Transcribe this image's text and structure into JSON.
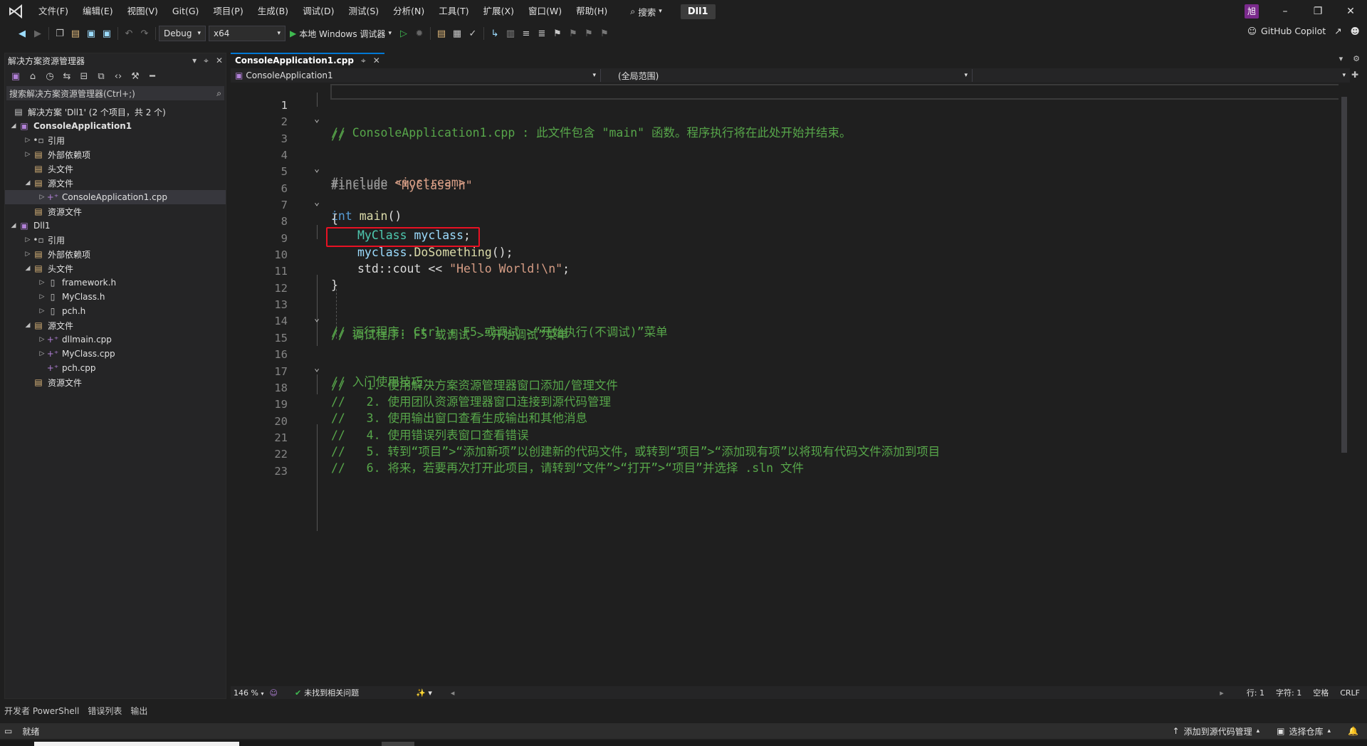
{
  "menubar": {
    "items": [
      "文件(F)",
      "编辑(E)",
      "视图(V)",
      "Git(G)",
      "项目(P)",
      "生成(B)",
      "调试(D)",
      "测试(S)",
      "分析(N)",
      "工具(T)",
      "扩展(X)",
      "窗口(W)",
      "帮助(H)"
    ],
    "search_label": "搜索",
    "project_name": "Dll1",
    "user_initial": "旭"
  },
  "toolbar": {
    "config": "Debug",
    "platform": "x64",
    "run_label": "本地 Windows 调试器",
    "copilot_label": "GitHub Copilot"
  },
  "solution_explorer": {
    "title": "解决方案资源管理器",
    "search_placeholder": "搜索解决方案资源管理器(Ctrl+;)",
    "solution_label": "解决方案 'Dll1' (2 个项目，共 2 个)",
    "nodes": [
      {
        "label": "ConsoleApplication1",
        "bold": true
      },
      {
        "label": "引用"
      },
      {
        "label": "外部依赖项"
      },
      {
        "label": "头文件"
      },
      {
        "label": "源文件"
      },
      {
        "label": "ConsoleApplication1.cpp"
      },
      {
        "label": "资源文件"
      },
      {
        "label": "Dll1"
      },
      {
        "label": "引用"
      },
      {
        "label": "外部依赖项"
      },
      {
        "label": "头文件"
      },
      {
        "label": "framework.h"
      },
      {
        "label": "MyClass.h"
      },
      {
        "label": "pch.h"
      },
      {
        "label": "源文件"
      },
      {
        "label": "dllmain.cpp"
      },
      {
        "label": "MyClass.cpp"
      },
      {
        "label": "pch.cpp"
      },
      {
        "label": "资源文件"
      }
    ]
  },
  "editor": {
    "tab_label": "ConsoleApplication1.cpp",
    "nav_project": "ConsoleApplication1",
    "nav_scope": "(全局范围)",
    "line_numbers": [
      "1",
      "2",
      "3",
      "4",
      "5",
      "6",
      "7",
      "8",
      "9",
      "10",
      "11",
      "12",
      "13",
      "14",
      "15",
      "16",
      "17",
      "18",
      "19",
      "20",
      "21",
      "22",
      "23"
    ],
    "code": {
      "l1": "// ConsoleApplication1.cpp : 此文件包含 \"main\" 函数。程序执行将在此处开始并结束。",
      "l2": "//",
      "l4_pp": "#include ",
      "l4_arg": "<iostream>",
      "l5_pp": "#include ",
      "l5_arg": "\"MyClass.h\"",
      "l6_kw": "int",
      "l6_fn": " main",
      "l6_rest": "()",
      "l7": "{",
      "l8_type": "MyClass",
      "l8_var": " myclass",
      "l8_rest": ";",
      "l9_var": "myclass",
      "l9_dot": ".",
      "l9_fn": "DoSomething",
      "l9_rest": "();",
      "l10_pre": "std::cout << ",
      "l10_str": "\"Hello World!\\n\"",
      "l10_rest": ";",
      "l11": "}",
      "l13": "// 运行程序: Ctrl + F5 或调试 >“开始执行(不调试)”菜单",
      "l14": "// 调试程序: F5 或调试 >“开始调试”菜单",
      "l16": "// 入门使用技巧:",
      "l17": "//   1. 使用解决方案资源管理器窗口添加/管理文件",
      "l18": "//   2. 使用团队资源管理器窗口连接到源代码管理",
      "l19": "//   3. 使用输出窗口查看生成输出和其他消息",
      "l20": "//   4. 使用错误列表窗口查看错误",
      "l21": "//   5. 转到“项目”>“添加新项”以创建新的代码文件，或转到“项目”>“添加现有项”以将现有代码文件添加到项目",
      "l22": "//   6. 将来，若要再次打开此项目，请转到“文件”>“打开”>“项目”并选择 .sln 文件"
    }
  },
  "editor_status": {
    "zoom": "146 %",
    "issues": "未找到相关问题",
    "line": "行: 1",
    "col": "字符: 1",
    "whitespace": "空格",
    "eol": "CRLF"
  },
  "bottom_tabs": [
    "开发者 PowerShell",
    "错误列表",
    "输出"
  ],
  "statusbar": {
    "ready": "就绪",
    "source_control": "添加到源代码管理",
    "repo": "选择仓库"
  }
}
